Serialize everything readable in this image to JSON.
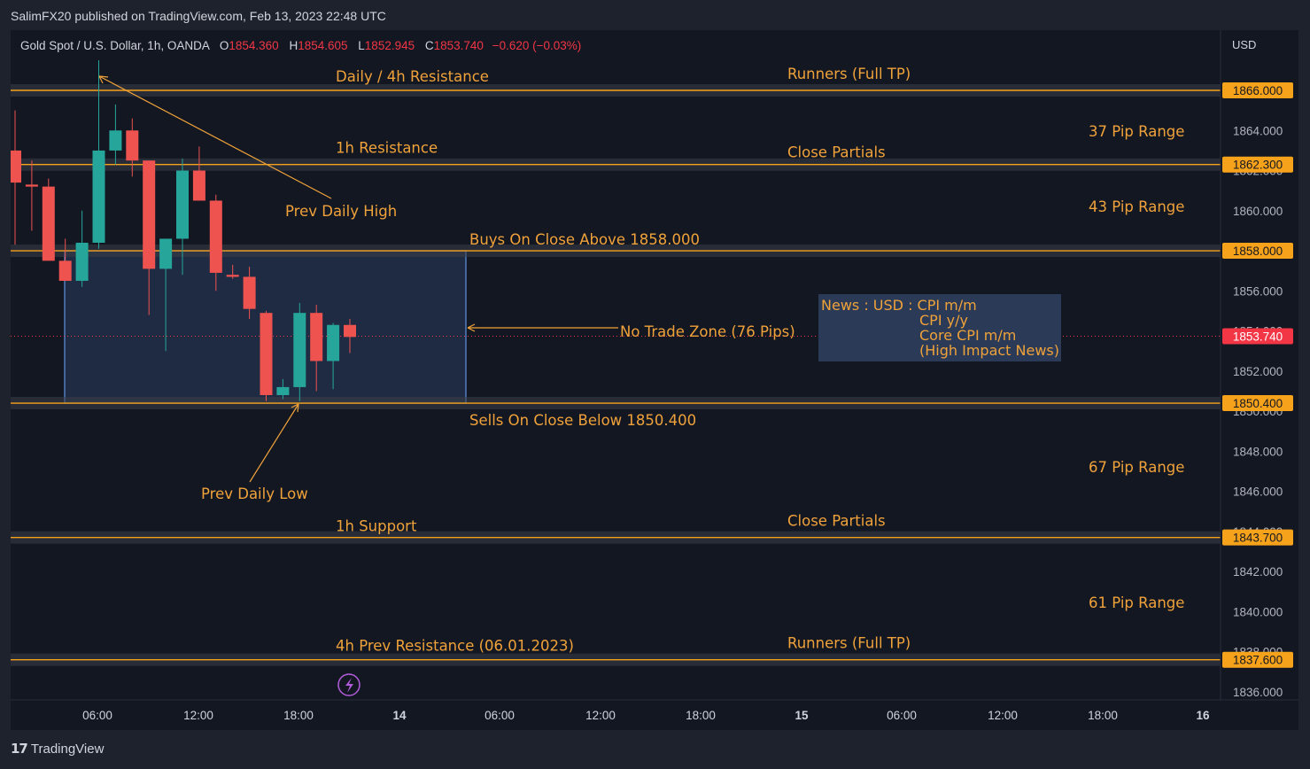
{
  "header": {
    "publisher": "SalimFX20 published on TradingView.com, Feb 13, 2023 22:48 UTC"
  },
  "legend": {
    "symbol": "Gold Spot / U.S. Dollar, 1h, OANDA",
    "open_label": "O",
    "open": "1854.360",
    "high_label": "H",
    "high": "1854.605",
    "low_label": "L",
    "low": "1852.945",
    "close_label": "C",
    "close": "1853.740",
    "change": "−0.620 (−0.03%)"
  },
  "footer": {
    "brand": "TradingView",
    "logo_glyph": "17"
  },
  "news_box": {
    "line1": "News : USD : CPI m/m",
    "line2": "CPI y/y",
    "line3": "Core CPI m/m",
    "line4": "(High Impact News)"
  },
  "colors": {
    "background": "#131722",
    "frame": "#1e222d",
    "grid": "#2a2e39",
    "bull": "#26a69a",
    "bear": "#ef5350",
    "level": "#f7a21b",
    "annotation": "#f0a23a",
    "zone": "#5b8bd6"
  },
  "chart_data": {
    "type": "candlestick",
    "symbol": "Gold Spot / U.S. Dollar",
    "interval": "1h",
    "currency_label": "USD",
    "ylim": [
      1835.0,
      1869.5
    ],
    "y_ticks": [
      "1836.000",
      "1838.000",
      "1840.000",
      "1842.000",
      "1844.000",
      "1846.000",
      "1848.000",
      "1850.000",
      "1852.000",
      "1854.000",
      "1856.000",
      "1858.000",
      "1860.000",
      "1862.000",
      "1864.000",
      "1866.000"
    ],
    "x_ticks": [
      "06:00",
      "12:00",
      "18:00",
      "14",
      "06:00",
      "12:00",
      "18:00",
      "15",
      "06:00",
      "12:00",
      "18:00",
      "16"
    ],
    "x_ticks_bold": [
      "14",
      "15",
      "16"
    ],
    "candles": [
      {
        "o": 1863.0,
        "h": 1865.0,
        "l": 1858.3,
        "c": 1861.4
      },
      {
        "o": 1861.3,
        "h": 1862.5,
        "l": 1859.0,
        "c": 1861.2
      },
      {
        "o": 1861.2,
        "h": 1861.6,
        "l": 1857.6,
        "c": 1857.5
      },
      {
        "o": 1857.5,
        "h": 1858.6,
        "l": 1856.8,
        "c": 1856.5
      },
      {
        "o": 1856.5,
        "h": 1860.0,
        "l": 1856.2,
        "c": 1858.4
      },
      {
        "o": 1858.4,
        "h": 1867.5,
        "l": 1858.1,
        "c": 1863.0
      },
      {
        "o": 1863.0,
        "h": 1865.3,
        "l": 1862.3,
        "c": 1864.0
      },
      {
        "o": 1864.0,
        "h": 1864.6,
        "l": 1861.7,
        "c": 1862.5
      },
      {
        "o": 1862.5,
        "h": 1862.5,
        "l": 1854.8,
        "c": 1857.1
      },
      {
        "o": 1857.1,
        "h": 1858.5,
        "l": 1853.0,
        "c": 1858.6
      },
      {
        "o": 1858.6,
        "h": 1862.6,
        "l": 1856.8,
        "c": 1862.0
      },
      {
        "o": 1862.0,
        "h": 1863.2,
        "l": 1860.9,
        "c": 1860.5
      },
      {
        "o": 1860.5,
        "h": 1860.8,
        "l": 1856.0,
        "c": 1856.9
      },
      {
        "o": 1856.8,
        "h": 1857.3,
        "l": 1856.6,
        "c": 1856.7
      },
      {
        "o": 1856.7,
        "h": 1857.2,
        "l": 1854.6,
        "c": 1855.1
      },
      {
        "o": 1854.9,
        "h": 1855.0,
        "l": 1850.5,
        "c": 1850.8
      },
      {
        "o": 1850.8,
        "h": 1851.6,
        "l": 1850.6,
        "c": 1851.2
      },
      {
        "o": 1851.2,
        "h": 1855.4,
        "l": 1850.5,
        "c": 1854.9
      },
      {
        "o": 1854.9,
        "h": 1855.3,
        "l": 1851.0,
        "c": 1852.5
      },
      {
        "o": 1852.5,
        "h": 1854.4,
        "l": 1851.1,
        "c": 1854.3
      },
      {
        "o": 1854.3,
        "h": 1854.6,
        "l": 1852.9,
        "c": 1853.7
      }
    ],
    "last_price": "1853.740",
    "levels": [
      {
        "price": 1866.0,
        "label": "1866.000",
        "left_text": "Daily / 4h Resistance",
        "right_text": "Runners (Full TP)"
      },
      {
        "price": 1862.3,
        "label": "1862.300",
        "left_text": "1h Resistance",
        "right_text": "Close Partials"
      },
      {
        "price": 1858.0,
        "label": "1858.000",
        "left_text": "Buys On Close Above 1858.000",
        "right_text": ""
      },
      {
        "price": 1850.4,
        "label": "1850.400",
        "left_text": "Sells On Close Below 1850.400",
        "right_text": ""
      },
      {
        "price": 1843.7,
        "label": "1843.700",
        "left_text": "1h Support",
        "right_text": "Close Partials"
      },
      {
        "price": 1837.6,
        "label": "1837.600",
        "left_text": "4h Prev Resistance (06.01.2023)",
        "right_text": "Runners (Full TP)"
      }
    ],
    "pip_ranges": [
      "37 Pip Range",
      "43 Pip Range",
      "67 Pip Range",
      "61 Pip Range"
    ],
    "annotations": {
      "prev_daily_high": "Prev Daily High",
      "prev_daily_low": "Prev Daily Low",
      "no_trade_zone": "No Trade Zone (76 Pips)"
    },
    "no_trade_zone": {
      "from_candle": 3,
      "to_candle": 24,
      "top": 1858.0,
      "bottom": 1850.4
    },
    "grid": false
  }
}
